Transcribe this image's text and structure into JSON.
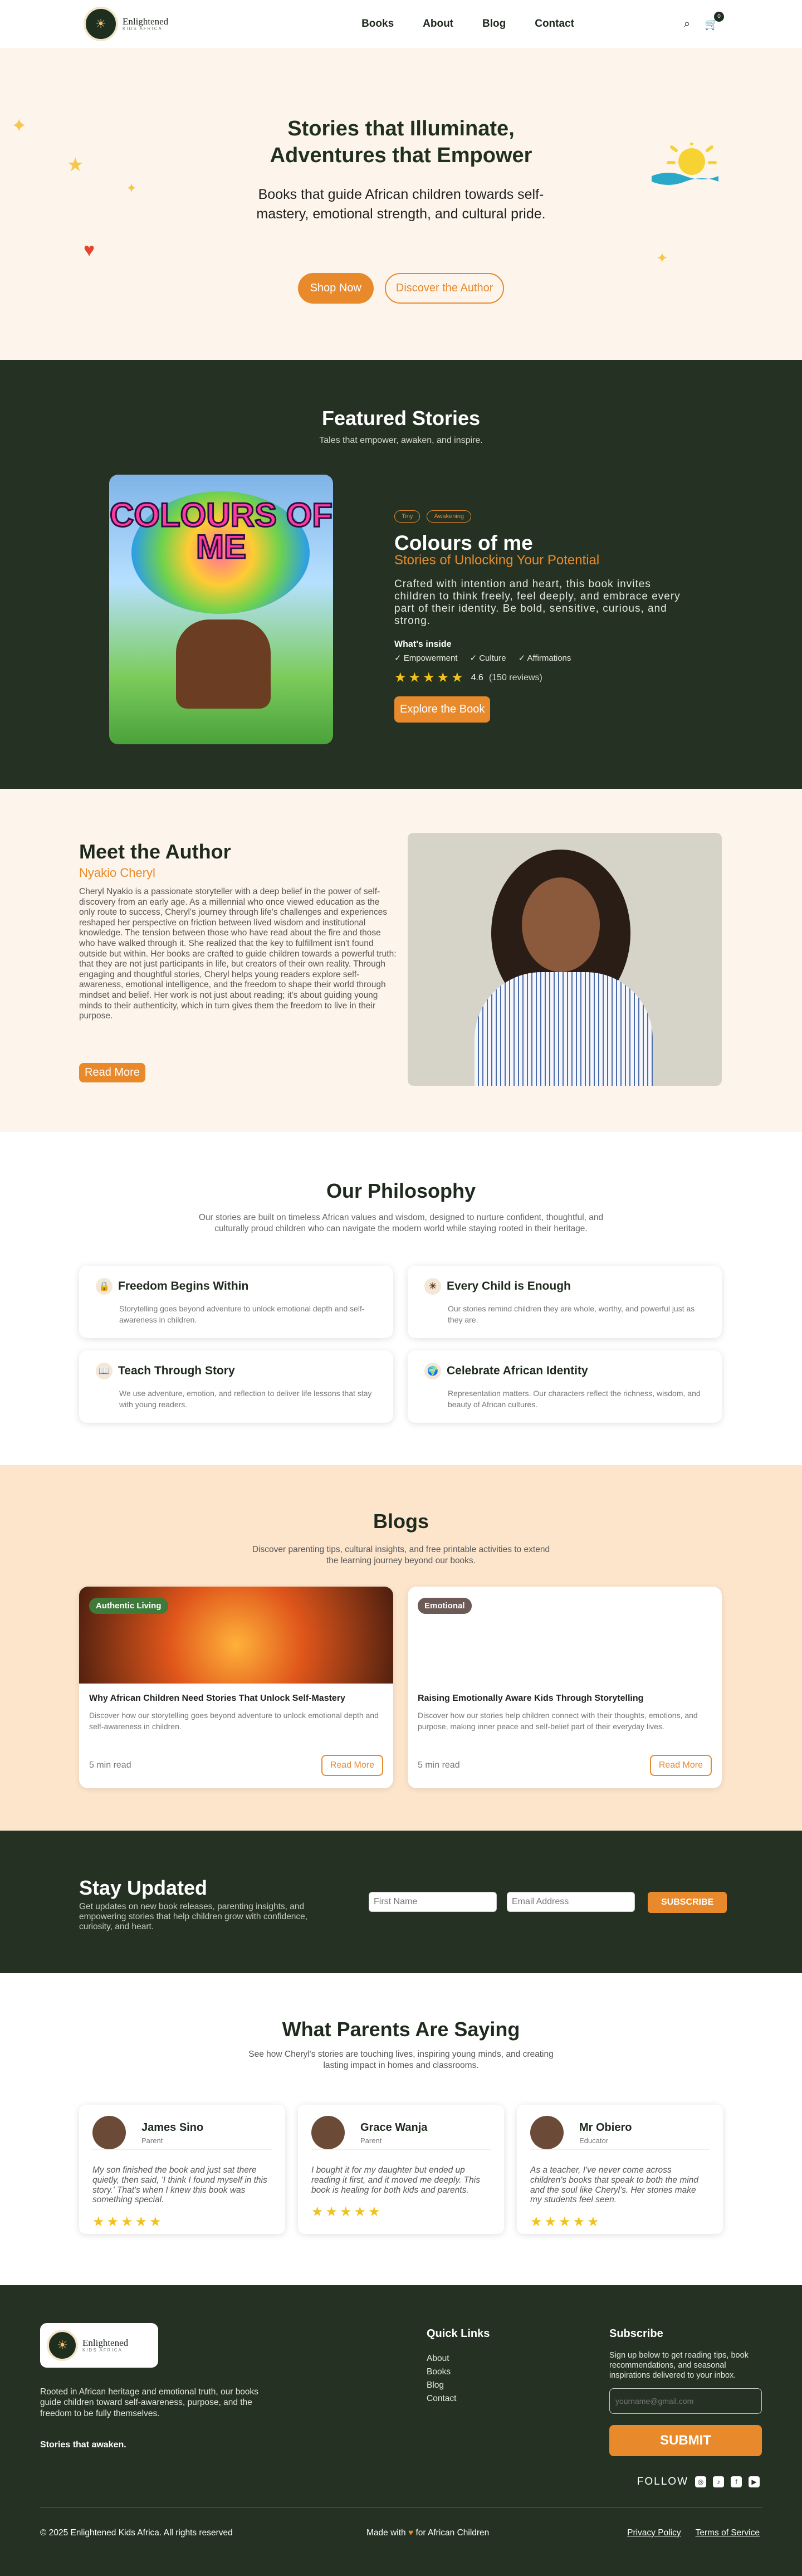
{
  "brand": {
    "name": "Enlightened",
    "sub": "KIDS AFRICA"
  },
  "nav": [
    "Books",
    "About",
    "Blog",
    "Contact"
  ],
  "cart_count": "0",
  "hero": {
    "title_line1": "Stories that Illuminate,",
    "title_line2": "Adventures that Empower",
    "subtitle": "Books that guide African children towards self-mastery, emotional strength, and cultural pride.",
    "shop_btn": "Shop Now",
    "author_btn": "Discover the Author"
  },
  "featured": {
    "title": "Featured Stories",
    "subtitle": "Tales that empower, awaken, and inspire.",
    "cover_title": "COLOURS OF ME",
    "tags": [
      "Tiny",
      "Awakening"
    ],
    "book_title": "Colours of me",
    "book_subtitle": "Stories of Unlocking Your Potential",
    "description": "Crafted with intention and heart, this book invites children to think freely, feel deeply, and embrace every part of their identity. Be bold, sensitive, curious, and strong.",
    "inside_label": "What's inside",
    "inside": [
      "Empowerment",
      "Culture",
      "Affirmations"
    ],
    "rating_value": "4.6",
    "reviews": "(150 reviews)",
    "cta": "Explore the Book"
  },
  "author": {
    "title": "Meet the Author",
    "name": "Nyakio Cheryl",
    "bio": "Cheryl Nyakio is a passionate storyteller with a deep belief in the power of self-discovery from an early age. As a millennial who once viewed education as the only route to success, Cheryl's journey through life's challenges and experiences reshaped her perspective on friction between lived wisdom and institutional knowledge. The tension between those who have read about the fire and those who have walked through it. She realized that the key to fulfillment isn't found outside but within. Her books are crafted to guide children towards a powerful truth: that they are not just participants in life, but creators of their own reality. Through engaging and thoughtful stories, Cheryl helps young readers explore self-awareness, emotional intelligence, and the freedom to shape their world through mindset and belief. Her work is not just about reading; it's about guiding young minds to their authenticity, which in turn gives them the freedom to live in their purpose.",
    "cta": "Read More"
  },
  "philosophy": {
    "title": "Our Philosophy",
    "subtitle": "Our stories are built on timeless African values and wisdom, designed to nurture confident, thoughtful, and culturally proud children who can navigate the modern world while staying rooted in their heritage.",
    "cards": [
      {
        "icon": "lock-icon",
        "title": "Freedom Begins Within",
        "desc": "Storytelling goes beyond adventure to unlock emotional depth and self-awareness in children."
      },
      {
        "icon": "sun-icon",
        "title": "Every Child is Enough",
        "desc": "Our stories remind children they are whole, worthy, and powerful just as they are."
      },
      {
        "icon": "book-icon",
        "title": "Teach Through Story",
        "desc": "We use adventure, emotion, and reflection to deliver life lessons that stay with young readers."
      },
      {
        "icon": "globe-icon",
        "title": "Celebrate African Identity",
        "desc": "Representation matters. Our characters reflect the richness, wisdom, and beauty of African cultures."
      }
    ]
  },
  "blogs": {
    "title": "Blogs",
    "subtitle": "Discover parenting tips, cultural insights, and free printable activities to extend the learning journey beyond our books.",
    "posts": [
      {
        "tag": "Authentic Living",
        "tag_color": "#3f7a3a",
        "title": "Why African Children Need Stories That Unlock Self-Mastery",
        "desc": "Discover how our storytelling goes beyond adventure to unlock emotional depth and self-awareness in children.",
        "read": "5 min read",
        "cta": "Read More"
      },
      {
        "tag": "Emotional",
        "tag_color": "#6b5a55",
        "title": "Raising Emotionally Aware Kids Through Storytelling",
        "desc": "Discover how our stories help children connect with their thoughts, emotions, and purpose, making inner peace and self-belief part of their everyday lives.",
        "read": "5 min read",
        "cta": "Read More"
      }
    ]
  },
  "newsletter": {
    "title": "Stay Updated",
    "text": "Get updates on new book releases, parenting insights, and empowering stories that help children grow with confidence, curiosity, and heart.",
    "first_name_ph": "First Name",
    "email_ph": "Email Address",
    "cta": "SUBSCRIBE"
  },
  "testimonials": {
    "title": "What Parents Are Saying",
    "subtitle": "See how Cheryl's stories are touching lives, inspiring young minds, and creating lasting impact in homes and classrooms.",
    "items": [
      {
        "name": "James Sino",
        "role": "Parent",
        "quote": "My son finished the book and just sat there quietly, then said, 'I think I found myself in this story.' That's when I knew this book was something special.",
        "rating": 5
      },
      {
        "name": "Grace Wanja",
        "role": "Parent",
        "quote": "I bought it for my daughter but ended up reading it first, and it moved me deeply. This book is healing for both kids and parents.",
        "rating": 5
      },
      {
        "name": "Mr Obiero",
        "role": "Educator",
        "quote": "As a teacher, I've never come across children's books that speak to both the mind and the soul like Cheryl's. Her stories make my students feel seen.",
        "rating": 5
      }
    ]
  },
  "footer": {
    "about": "Rooted in African heritage and emotional truth, our books guide children toward self-awareness, purpose, and the freedom to be fully themselves.",
    "tagline": "Stories that awaken.",
    "quick_links_title": "Quick Links",
    "links": [
      "About",
      "Books",
      "Blog",
      "Contact"
    ],
    "subscribe_title": "Subscribe",
    "subscribe_text": "Sign up below to get reading tips, book recommendations, and seasonal inspirations delivered to your inbox.",
    "email_ph": "yourname@gmail.com",
    "submit": "SUBMIT",
    "follow": "FOLLOW",
    "copyright": "2025 Enlightened Kids Africa. All rights reserved",
    "made_with": "Made with",
    "made_for": "for African Children",
    "privacy": "Privacy Policy",
    "terms": "Terms of Service"
  }
}
